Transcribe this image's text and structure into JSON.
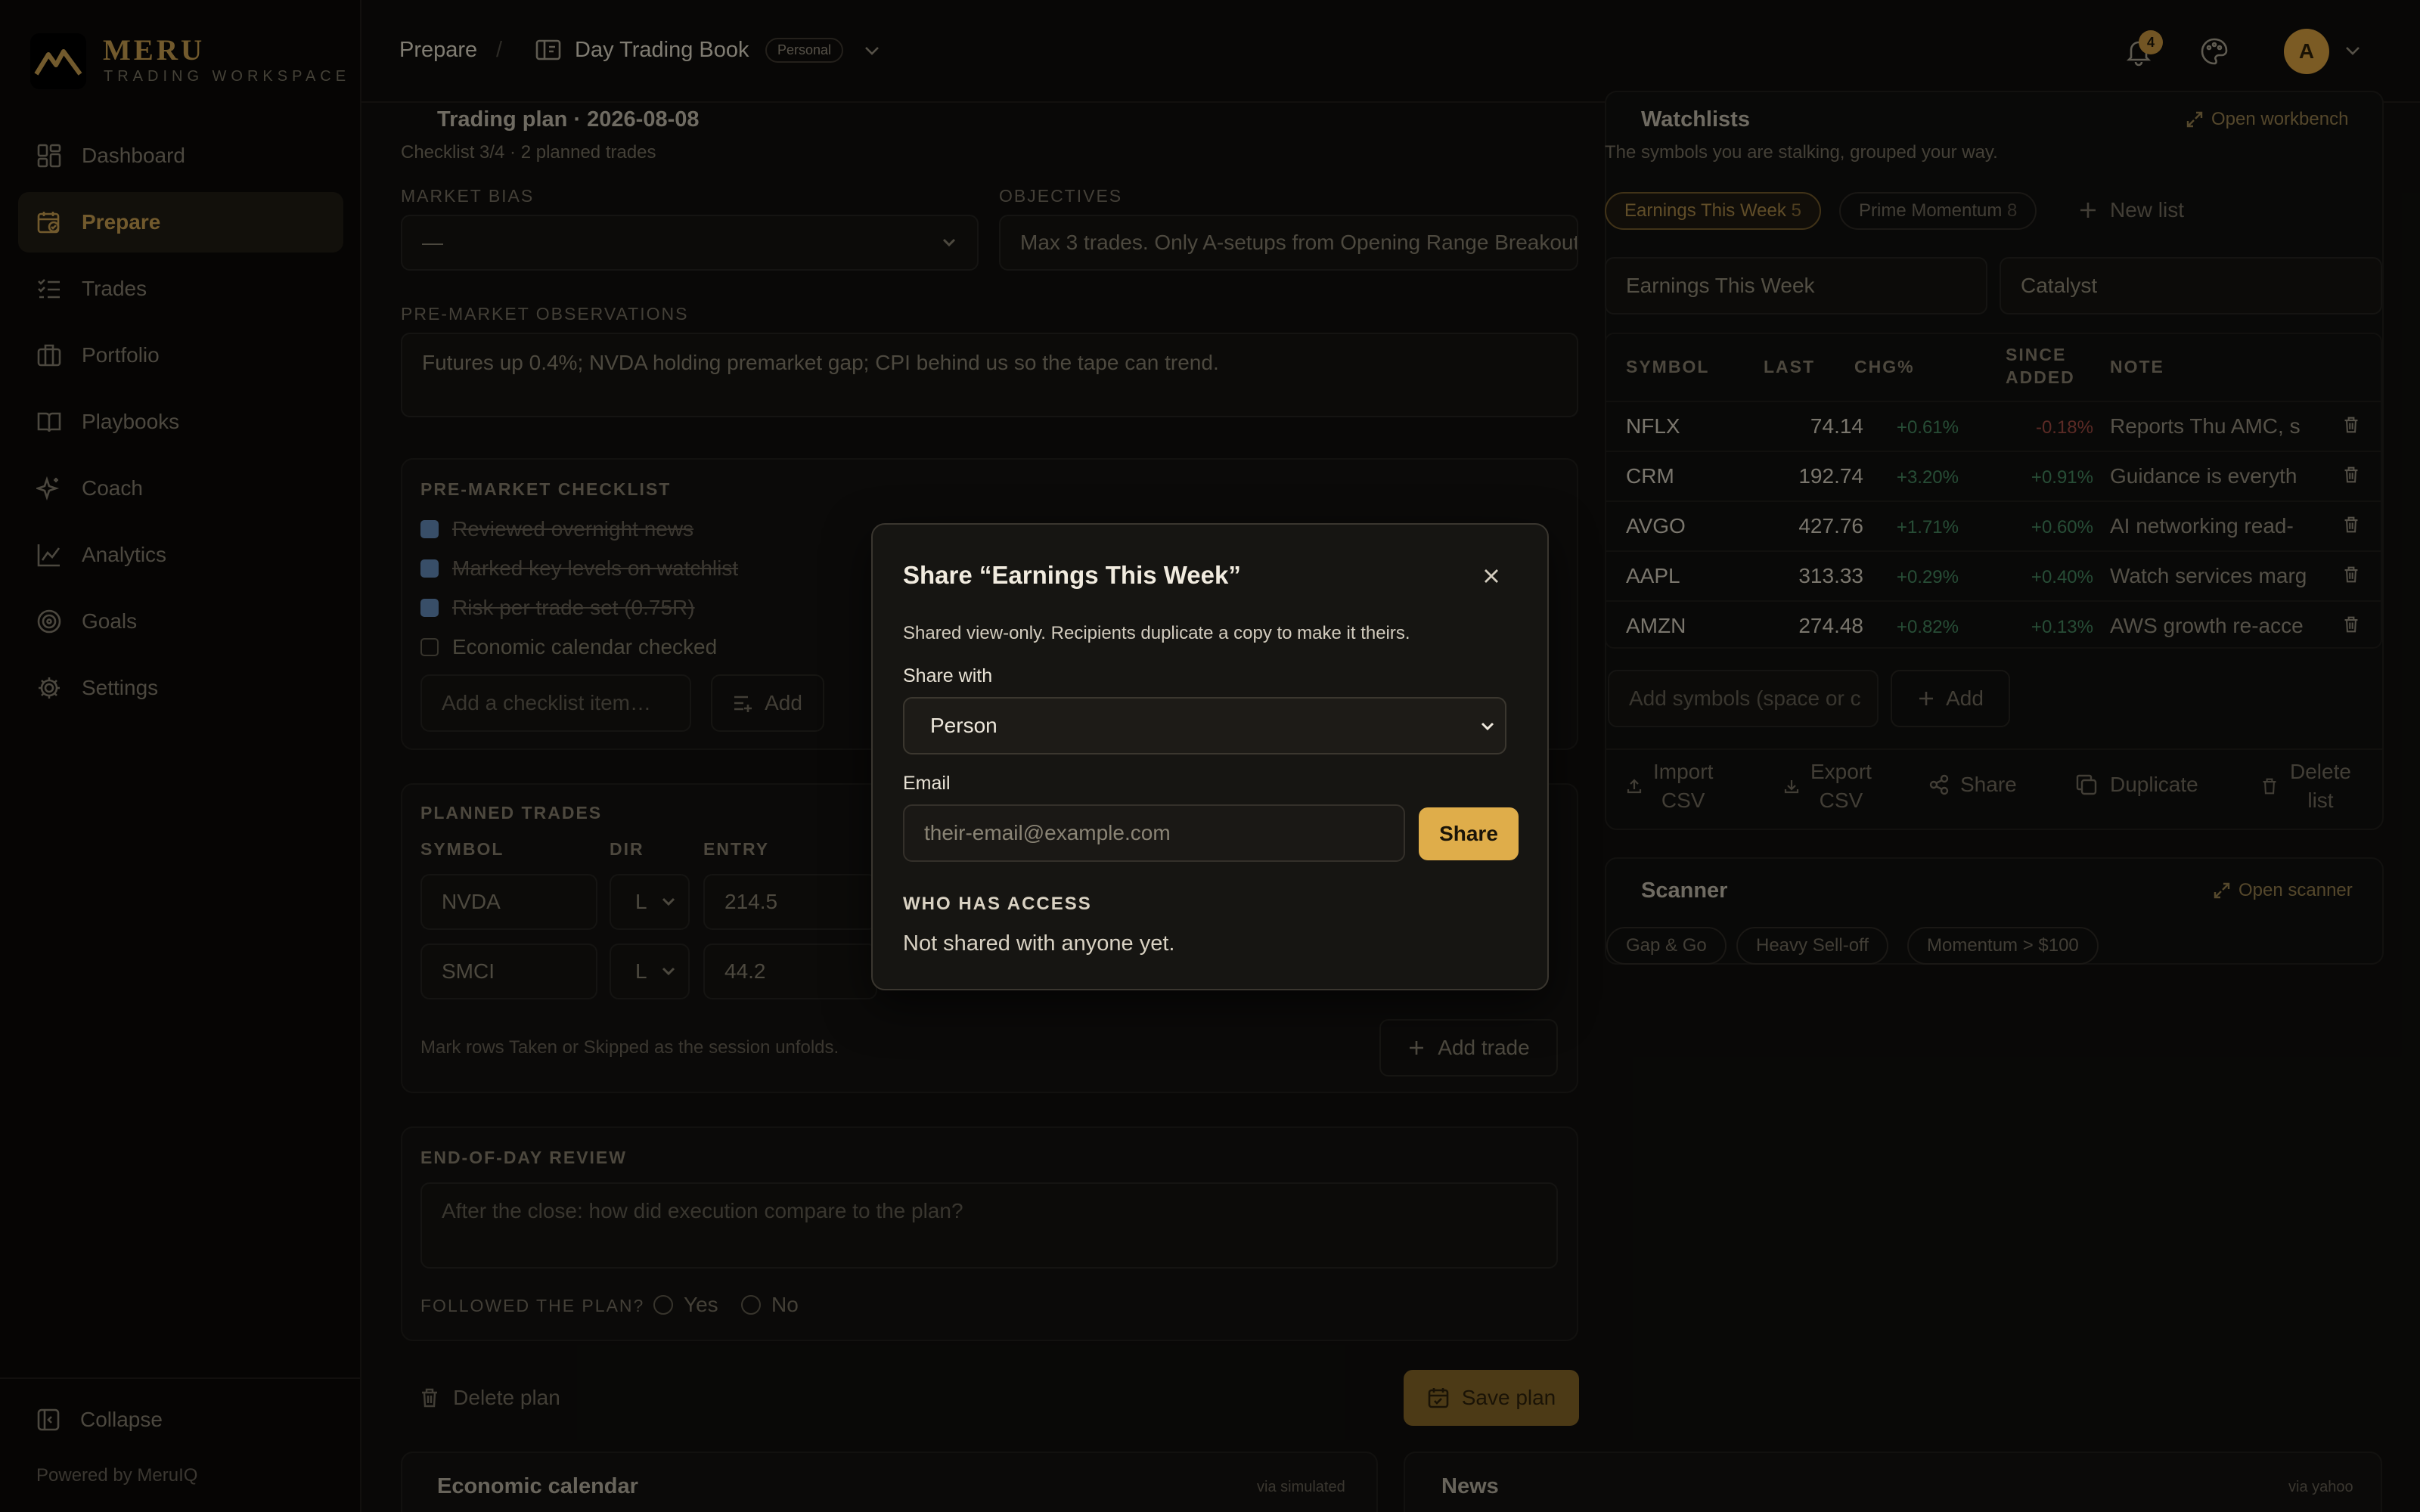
{
  "app": {
    "brand": "MERU",
    "brand_sub": "TRADING WORKSPACE",
    "powered_by": "Powered by MeruIQ",
    "collapse": "Collapse"
  },
  "nav": [
    {
      "label": "Dashboard",
      "icon": "dashboard-icon"
    },
    {
      "label": "Prepare",
      "icon": "calendar-check-icon",
      "active": true
    },
    {
      "label": "Trades",
      "icon": "list-check-icon"
    },
    {
      "label": "Portfolio",
      "icon": "briefcase-icon"
    },
    {
      "label": "Playbooks",
      "icon": "book-icon"
    },
    {
      "label": "Coach",
      "icon": "sparkles-icon"
    },
    {
      "label": "Analytics",
      "icon": "line-chart-icon"
    },
    {
      "label": "Goals",
      "icon": "target-icon"
    },
    {
      "label": "Settings",
      "icon": "gear-icon"
    }
  ],
  "topbar": {
    "crumb1": "Prepare",
    "sep": "/",
    "crumb2": "Day Trading Book",
    "badge": "Personal",
    "notif_count": "4",
    "avatar": "A"
  },
  "plan": {
    "title": "Trading plan · 2026-08-08",
    "subtitle": "Checklist 3/4 · 2 planned trades",
    "bias_label": "MARKET BIAS",
    "bias_value": "—",
    "objectives_label": "OBJECTIVES",
    "objectives_value": "Max 3 trades. Only A-setups from Opening Range Breakout",
    "obs_label": "PRE-MARKET OBSERVATIONS",
    "obs_value": "Futures up 0.4%; NVDA holding premarket gap; CPI behind us so the tape can trend.",
    "checklist_label": "PRE-MARKET CHECKLIST",
    "checklist": [
      {
        "text": "Reviewed overnight news",
        "done": true
      },
      {
        "text": "Marked key levels on watchlist",
        "done": true
      },
      {
        "text": "Risk per trade set (0.75R)",
        "done": true
      },
      {
        "text": "Economic calendar checked",
        "done": false
      }
    ],
    "add_item_placeholder": "Add a checklist item…",
    "add_label": "Add",
    "planned_label": "PLANNED TRADES",
    "cols": [
      "SYMBOL",
      "DIR",
      "ENTRY"
    ],
    "trades": [
      {
        "symbol": "NVDA",
        "dir": "L",
        "entry": "214.5"
      },
      {
        "symbol": "SMCI",
        "dir": "L",
        "entry": "44.2"
      }
    ],
    "trades_hint": "Mark rows Taken or Skipped as the session unfolds.",
    "add_trade": "Add trade",
    "eod_label": "END-OF-DAY REVIEW",
    "eod_placeholder": "After the close: how did execution compare to the plan?",
    "followed_label": "FOLLOWED THE PLAN?",
    "yes": "Yes",
    "no": "No",
    "delete_plan": "Delete plan",
    "save_plan": "Save plan"
  },
  "bottom": {
    "econ_title": "Economic calendar",
    "econ_src": "via simulated",
    "news_title": "News",
    "news_src": "via yahoo"
  },
  "watchlists": {
    "title": "Watchlists",
    "open": "Open workbench",
    "desc": "The symbols you are stalking, grouped your way.",
    "lists": [
      {
        "name": "Earnings This Week",
        "count": "5",
        "active": true
      },
      {
        "name": "Prime Momentum",
        "count": "8",
        "active": false
      }
    ],
    "new_list": "New list",
    "name_value": "Earnings This Week",
    "tag_value": "Catalyst",
    "cols": {
      "symbol": "SYMBOL",
      "last": "LAST",
      "chg": "CHG%",
      "since1": "SINCE",
      "since2": "ADDED",
      "note": "NOTE"
    },
    "rows": [
      {
        "symbol": "NFLX",
        "last": "74.14",
        "chg": "+0.61%",
        "since": "-0.18%",
        "since_neg": true,
        "note": "Reports Thu AMC, s"
      },
      {
        "symbol": "CRM",
        "last": "192.74",
        "chg": "+3.20%",
        "since": "+0.91%",
        "since_neg": false,
        "note": "Guidance is everyth"
      },
      {
        "symbol": "AVGO",
        "last": "427.76",
        "chg": "+1.71%",
        "since": "+0.60%",
        "since_neg": false,
        "note": "AI networking read-"
      },
      {
        "symbol": "AAPL",
        "last": "313.33",
        "chg": "+0.29%",
        "since": "+0.40%",
        "since_neg": false,
        "note": "Watch services marg"
      },
      {
        "symbol": "AMZN",
        "last": "274.48",
        "chg": "+0.82%",
        "since": "+0.13%",
        "since_neg": false,
        "note": "AWS growth re-acce"
      }
    ],
    "add_symbols_placeholder": "Add symbols (space or c",
    "add": "Add",
    "actions": [
      {
        "l1": "Import",
        "l2": "CSV"
      },
      {
        "l1": "Export",
        "l2": "CSV"
      },
      {
        "l1": "Share",
        "l2": ""
      },
      {
        "l1": "Duplicate",
        "l2": ""
      },
      {
        "l1": "Delete",
        "l2": "list"
      }
    ]
  },
  "scanner": {
    "title": "Scanner",
    "open": "Open scanner",
    "chips": [
      "Gap & Go",
      "Heavy Sell-off",
      "Momentum > $100"
    ]
  },
  "modal": {
    "title": "Share “Earnings This Week”",
    "desc": "Shared view-only. Recipients duplicate a copy to make it theirs.",
    "share_with_label": "Share with",
    "share_with_value": "Person",
    "email_label": "Email",
    "email_placeholder": "their-email@example.com",
    "share_button": "Share",
    "access_label": "WHO HAS ACCESS",
    "access_value": "Not shared with anyone yet."
  },
  "colors": {
    "accent": "#dfad4a",
    "brand": "#b9924a",
    "positive": "#3f7d58",
    "negative": "#93443c"
  }
}
